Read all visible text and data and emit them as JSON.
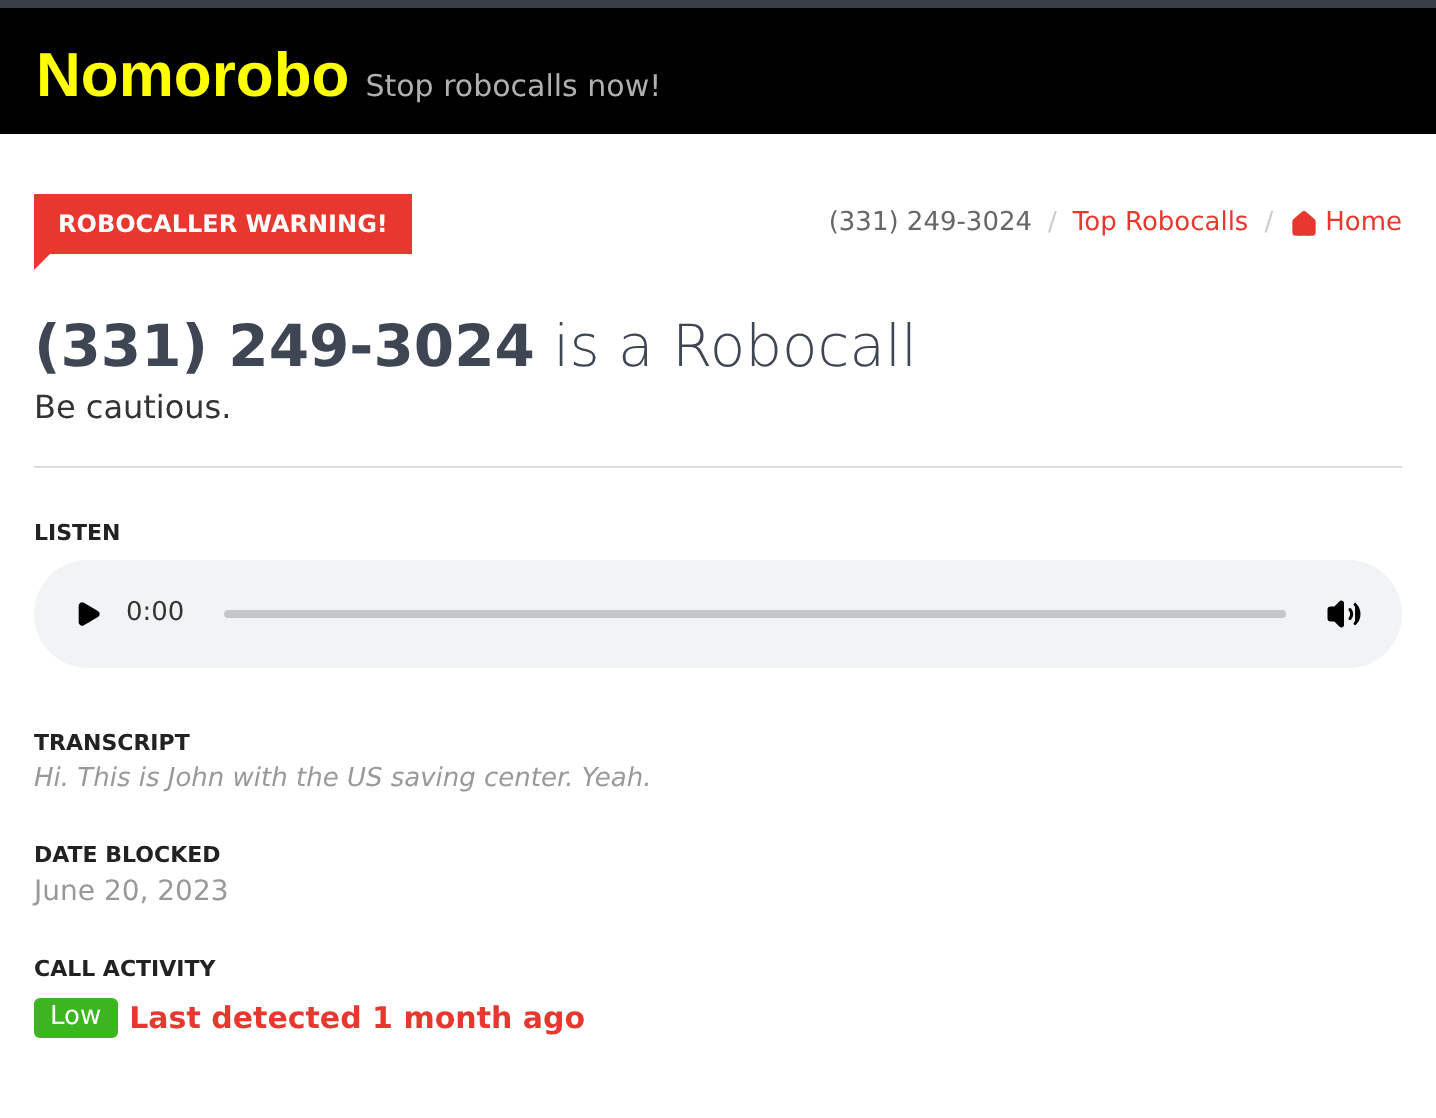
{
  "header": {
    "logo": "Nomorobo",
    "tagline": "Stop robocalls now!"
  },
  "warning_badge": "ROBOCALLER WARNING!",
  "breadcrumb": {
    "separator": "/",
    "items": [
      {
        "label": "(331) 249-3024",
        "kind": "text"
      },
      {
        "label": "Top Robocalls",
        "kind": "link"
      },
      {
        "label": "Home",
        "kind": "home"
      }
    ]
  },
  "title": {
    "number": "(331) 249-3024",
    "suffix": "is a Robocall"
  },
  "subtitle": "Be cautious.",
  "listen": {
    "label": "LISTEN",
    "time": "0:00"
  },
  "transcript": {
    "label": "TRANSCRIPT",
    "text": "Hi. This is John with the US saving center. Yeah."
  },
  "date_blocked": {
    "label": "DATE BLOCKED",
    "value": "June 20, 2023"
  },
  "call_activity": {
    "label": "CALL ACTIVITY",
    "badge": "Low",
    "color": "#3cb521",
    "detail": "Last detected 1 month ago"
  }
}
